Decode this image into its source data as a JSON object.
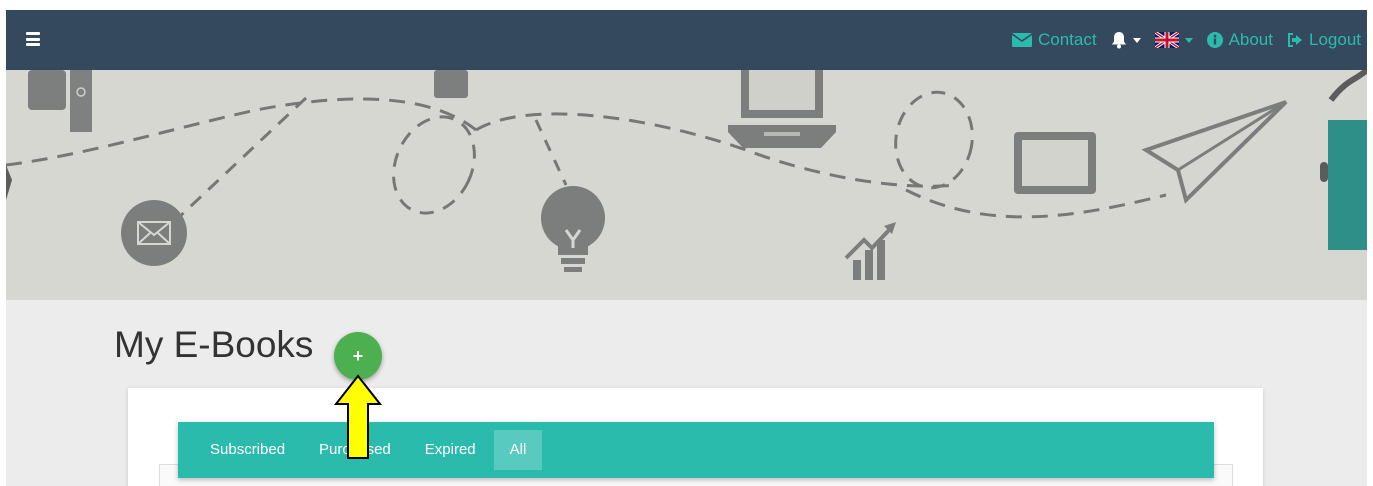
{
  "navbar": {
    "menu_icon": "hamburger-icon",
    "contact_label": "Contact",
    "about_label": "About",
    "logout_label": "Logout",
    "language_flag": "uk-flag-icon",
    "accent_color": "#2bbbad",
    "background_color": "#34495e"
  },
  "banner": {
    "description_icons": [
      "envelope-icon",
      "lightbulb-icon",
      "laptop-icon",
      "tablet-icon",
      "paper-plane-icon",
      "growth-chart-icon"
    ]
  },
  "page": {
    "title": "My E-Books",
    "add_button_label": "+"
  },
  "tabs": [
    {
      "label": "Subscribed",
      "active": false
    },
    {
      "label": "Purchased",
      "active": false
    },
    {
      "label": "Expired",
      "active": false
    },
    {
      "label": "All",
      "active": true
    }
  ],
  "colors": {
    "add_button": "#4caf50",
    "tabbar": "#2bbbad",
    "annotation_arrow": "#ffff00"
  }
}
